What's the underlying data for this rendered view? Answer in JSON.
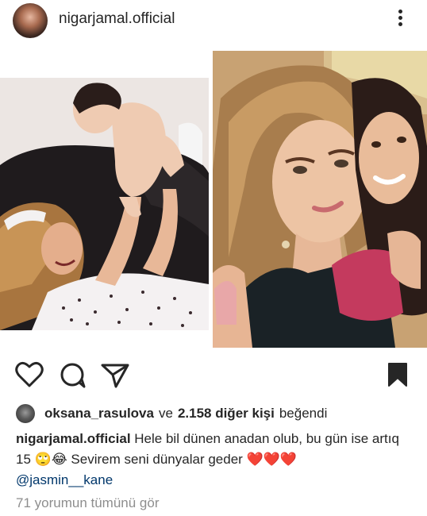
{
  "post": {
    "username": "nigarjamal.official"
  },
  "actions": {
    "like_icon": "heart-outline-icon",
    "comment_icon": "comment-bubble-icon",
    "share_icon": "paper-plane-icon",
    "save_icon": "bookmark-filled-icon"
  },
  "likes": {
    "liker": "oksana_rasulova",
    "connector": "ve",
    "others": "2.158 diğer kişi",
    "suffix": "beğendi"
  },
  "caption": {
    "author": "nigarjamal.official",
    "text_1": "Hele bil dünen anadan olub, bu gün ise artıq 15",
    "emojis": "🙄😂",
    "text_2": "Sevirem seni dünyalar geder",
    "hearts": "❤️❤️❤️",
    "mention": "@jasmin__kane"
  },
  "comments_link": "71 yorumun tümünü gör",
  "colors": {
    "text": "#262626",
    "muted": "#8e8e8e",
    "mention": "#00376b",
    "heart_red": "#d91c2a"
  }
}
